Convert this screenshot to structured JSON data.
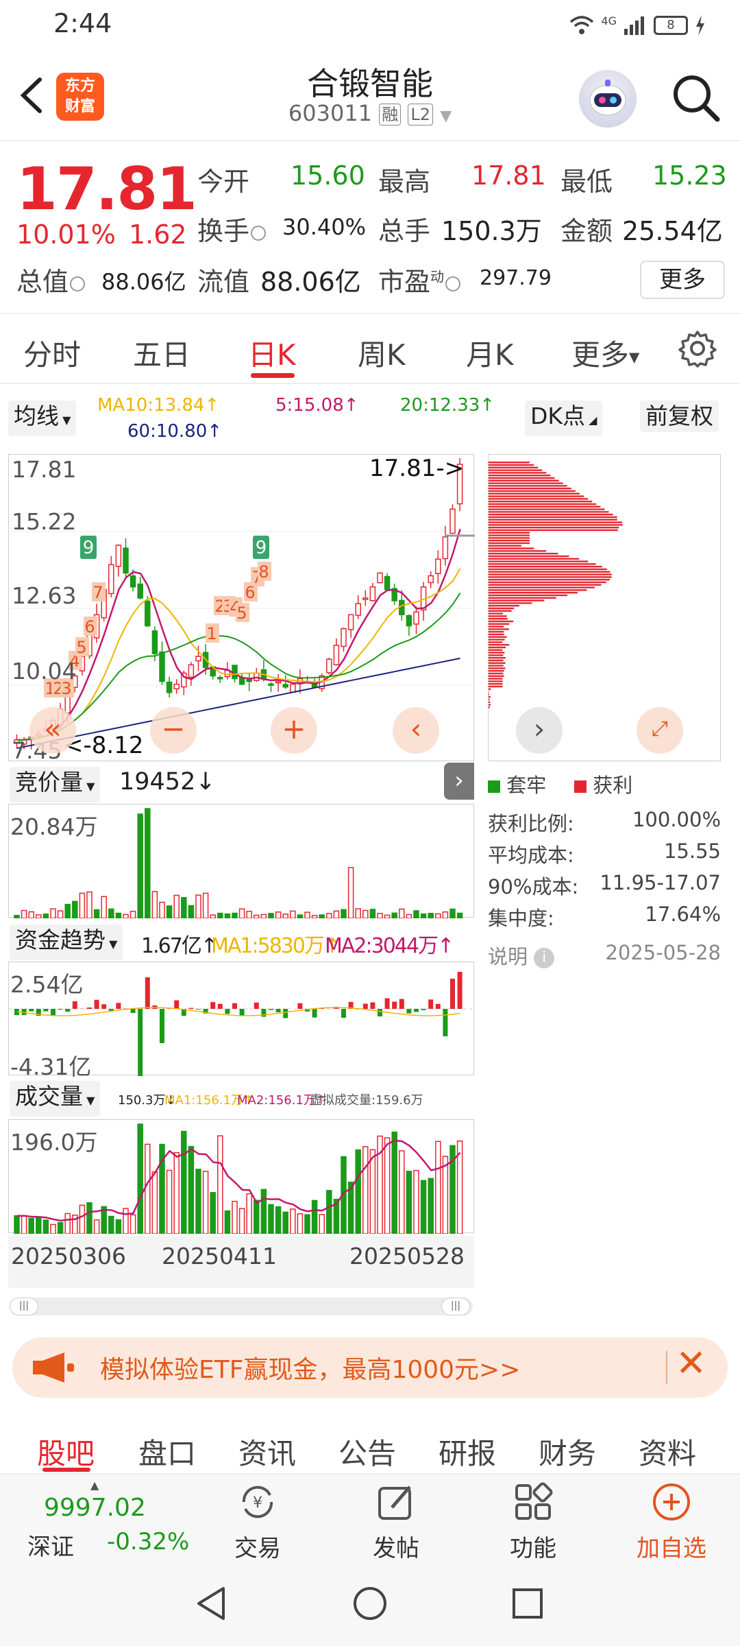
{
  "status": {
    "time": "2:44",
    "battery": "8",
    "network": "4G"
  },
  "header": {
    "logo_line1": "东方",
    "logo_line2": "财富",
    "stock_name": "合锻智能",
    "stock_code": "603011",
    "tag_margin": "融",
    "tag_level": "L2"
  },
  "quote": {
    "price": "17.81",
    "change_pct": "10.01%",
    "change": "1.62",
    "open_label": "今开",
    "open": "15.60",
    "high_label": "最高",
    "high": "17.81",
    "low_label": "最低",
    "low": "15.23",
    "turnover_label": "换手",
    "turnover": "30.40%",
    "volume_label": "总手",
    "volume": "150.3万",
    "amount_label": "金额",
    "amount": "25.54亿",
    "mktcap_label": "总值",
    "mktcap": "88.06亿",
    "float_label": "流值",
    "float_cap": "88.06亿",
    "pe_label": "市盈",
    "pe_sup": "动",
    "pe": "297.79",
    "more_label": "更多"
  },
  "tabs": [
    "分时",
    "五日",
    "日K",
    "周K",
    "月K",
    "更多"
  ],
  "active_tab": "日K",
  "indicators": {
    "ma_selector": "均线",
    "ma10": "MA10:13.84↑",
    "ma5": "5:15.08↑",
    "ma20": "20:12.33↑",
    "ma60": "60:10.80↑",
    "dk_label": "DK点",
    "adjust_label": "前复权"
  },
  "kline": {
    "y_labels": [
      "17.81",
      "15.22",
      "12.63",
      "10.04",
      "7.45"
    ],
    "high_marker": "17.81->",
    "low_marker": "<-8.12",
    "seq_numbers": [
      "1",
      "2",
      "3",
      "4",
      "5",
      "6",
      "7",
      "8",
      "9"
    ]
  },
  "volume_panel": {
    "selector": "竞价量",
    "value": "19452↓",
    "y_label": "20.84万"
  },
  "fund_panel": {
    "selector": "资金趋势",
    "value": "1.67亿↑",
    "ma1": "MA1:5830万↑",
    "ma2": "MA2:3044万↑",
    "y_top": "2.54亿",
    "y_bottom": "-4.31亿"
  },
  "cj_panel": {
    "selector": "成交量",
    "value": "150.3万↓",
    "ma1": "MA1:156.1万↑",
    "ma2": "MA2:156.1万↑",
    "virtual": "虚拟成交量:159.6万",
    "y_label": "196.0万"
  },
  "dates": [
    "20250306",
    "20250411",
    "20250528"
  ],
  "chip": {
    "legend_trap": "套牢",
    "legend_profit": "获利",
    "rows": [
      {
        "label": "获利比例:",
        "value": "100.00%"
      },
      {
        "label": "平均成本:",
        "value": "15.55"
      },
      {
        "label": "90%成本:",
        "value": "11.95-17.07"
      },
      {
        "label": "集中度:",
        "value": "17.64%"
      }
    ],
    "note_label": "说明",
    "date": "2025-05-28"
  },
  "banner": {
    "text": "模拟体验ETF赢现金，最高1000元>>"
  },
  "bottom_tabs": [
    "股吧",
    "盘口",
    "资讯",
    "公告",
    "研报",
    "财务",
    "资料"
  ],
  "bottom_active": "股吧",
  "navbar": {
    "index_value": "9997.02",
    "index_name": "深证",
    "index_change": "-0.32%",
    "trade": "交易",
    "post": "发帖",
    "func": "功能",
    "add": "加自选"
  },
  "colors": {
    "up": "#e5262f",
    "down": "#1a9b1a",
    "ma5": "#c2186b",
    "ma10": "#f0b400",
    "ma20": "#1a9b1a",
    "ma60": "#1a237e",
    "accent": "#e5531f"
  }
}
